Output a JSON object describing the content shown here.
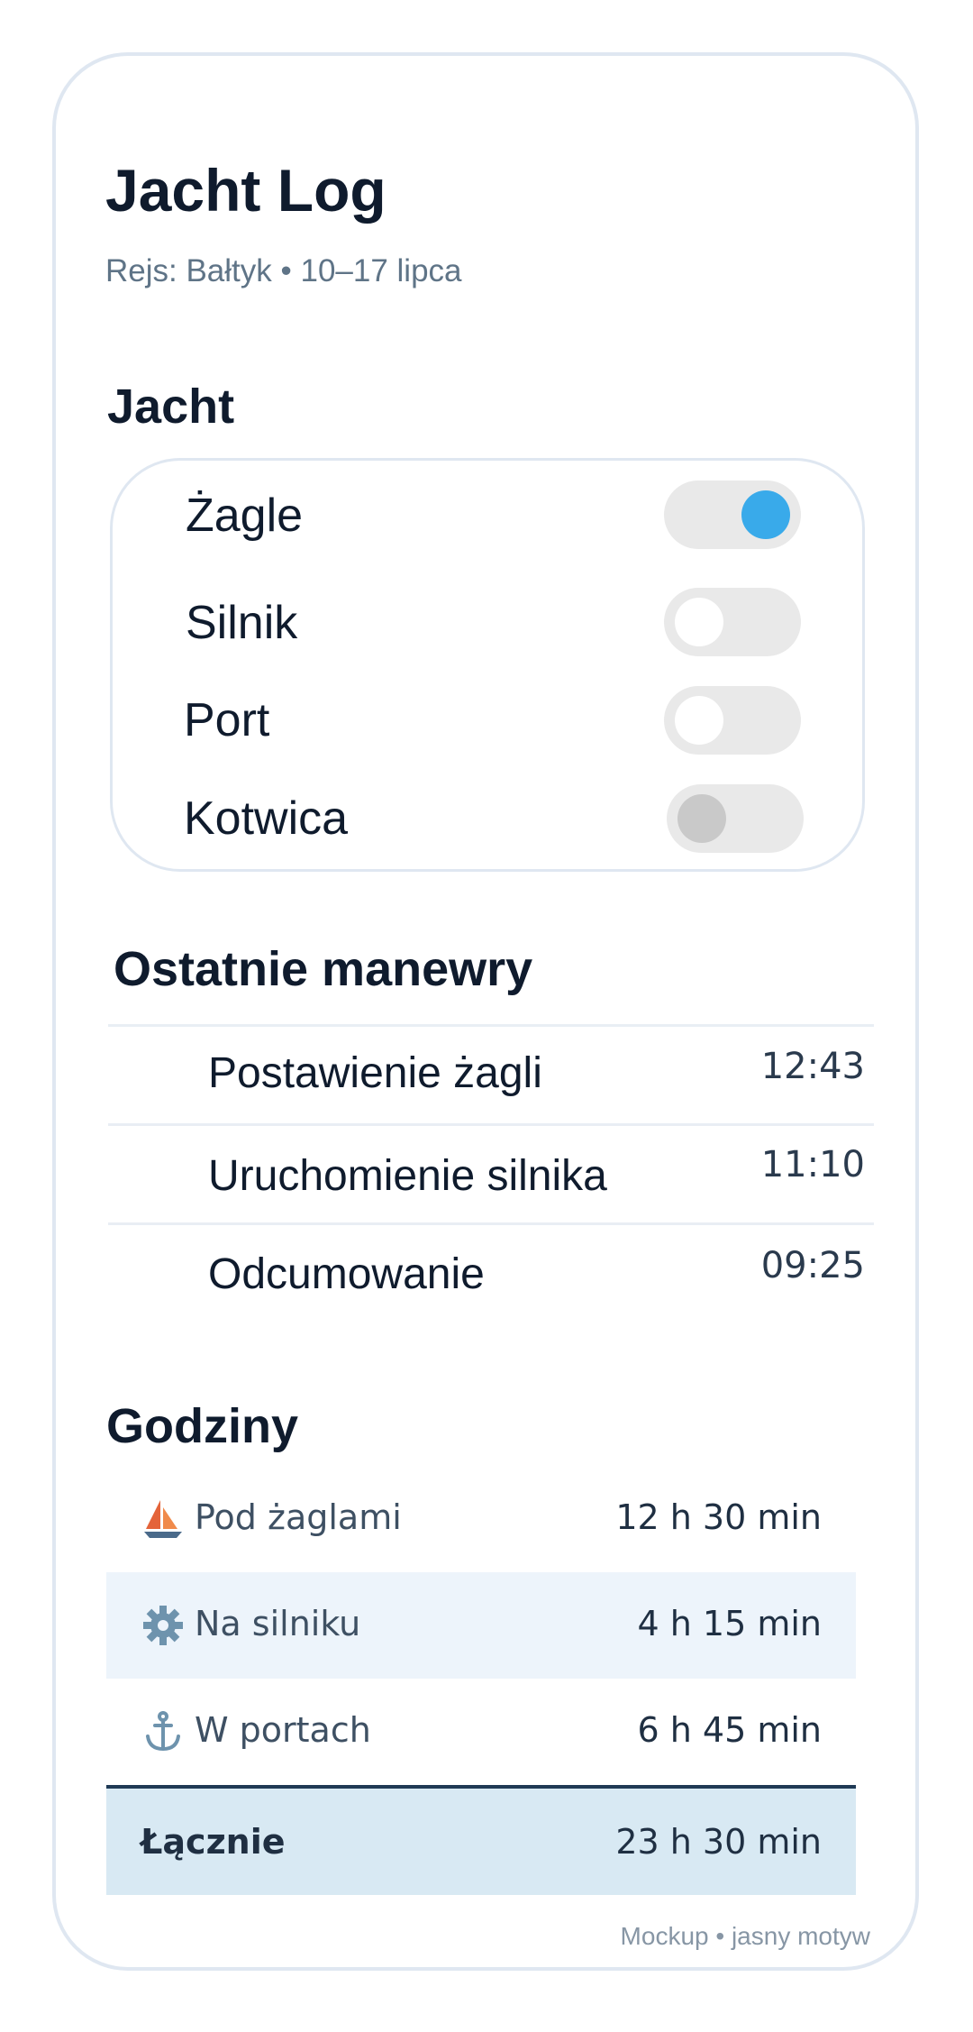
{
  "app": {
    "title": "Jacht Log",
    "subtitle": "Rejs: Bałtyk • 10–17 lipca"
  },
  "yacht": {
    "title": "Jacht",
    "toggles": [
      {
        "label": "Żagle",
        "state": "on"
      },
      {
        "label": "Silnik",
        "state": "off"
      },
      {
        "label": "Port",
        "state": "off"
      },
      {
        "label": "Kotwica",
        "state": "disabled"
      }
    ]
  },
  "maneuvers": {
    "title": "Ostatnie manewry",
    "items": [
      {
        "label": "Postawienie żagli",
        "time": "12:43"
      },
      {
        "label": "Uruchomienie silnika",
        "time": "11:10"
      },
      {
        "label": "Odcumowanie",
        "time": "09:25"
      }
    ]
  },
  "hours": {
    "title": "Godziny",
    "rows": [
      {
        "icon": "sailboat-icon",
        "label": "Pod żaglami",
        "value": "12 h 30 min"
      },
      {
        "icon": "gear-icon",
        "label": "Na silniku",
        "value": "4 h 15 min"
      },
      {
        "icon": "anchor-icon",
        "label": "W portach",
        "value": "6 h 45 min"
      }
    ],
    "total": {
      "label": "Łącznie",
      "value": "23 h 30 min"
    }
  },
  "footer": "Mockup • jasny motyw",
  "colors": {
    "accent": "#39aaea",
    "text": "#0f1b2d",
    "muted": "#5f7487",
    "border": "#dfe7f1",
    "row_alt": "#edf4fb",
    "row_total": "#d8e9f3"
  }
}
